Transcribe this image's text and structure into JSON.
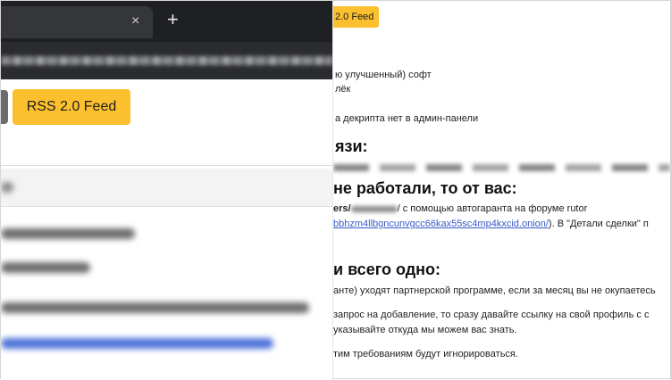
{
  "left_panel": {
    "tab": {
      "close_glyph": "×"
    },
    "new_tab_glyph": "+",
    "rss_button_label": "RSS 2.0 Feed"
  },
  "right_panel": {
    "rss_button_label": "2.0 Feed",
    "lines": {
      "l1": "ю улучшенный) софт",
      "l2": "лёк",
      "l3": "а декрипта нет в админ-панели",
      "heading1": "язи:",
      "heading2": "не работали, то от вас:",
      "l4_prefix": "ers/",
      "l4_suffix": "/ с помощью автогаранта на форуме rutor",
      "l5_link": "bbhzm4llbgncunvgcc66kax55sc4mp4kxcid.onion/",
      "l5_suffix": "). В \"Детали сделки\" п",
      "heading3": "и всего одно:",
      "l6": "анте) уходят партнерской программе, если за месяц вы не окупаетесь",
      "l7": "запрос на добавление, то сразу давайте ссылку на свой профиль с с",
      "l8": "указывайте откуда мы можем вас знать.",
      "l9": "тим требованиям будут игнорироваться."
    }
  },
  "colors": {
    "accent_yellow": "#fcc02e",
    "link_blue": "#3a59c7",
    "browser_dark": "#1f2023"
  }
}
